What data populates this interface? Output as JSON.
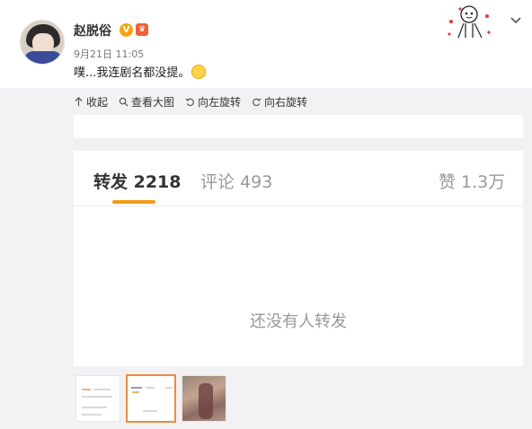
{
  "post": {
    "username": "赵脱俗",
    "verified_badge": "V",
    "member_badge": "♛",
    "time": "9月21日 11:05",
    "text": "噗...我连剧名都没提。"
  },
  "toolbar": {
    "collapse_label": "收起",
    "view_large_label": "查看大图",
    "rotate_left_label": "向左旋转",
    "rotate_right_label": "向右旋转"
  },
  "image_content": {
    "tab_repost": "转发 2218",
    "tab_comment": "评论 493",
    "tab_like": "赞 1.3万",
    "empty_message": "还没有人转发"
  },
  "thumbnails": {
    "count": 3,
    "selected_index": 1
  },
  "colors": {
    "accent": "#f39a1a",
    "thumb_selected_border": "#f08a3c",
    "verified": "#f7a310"
  }
}
